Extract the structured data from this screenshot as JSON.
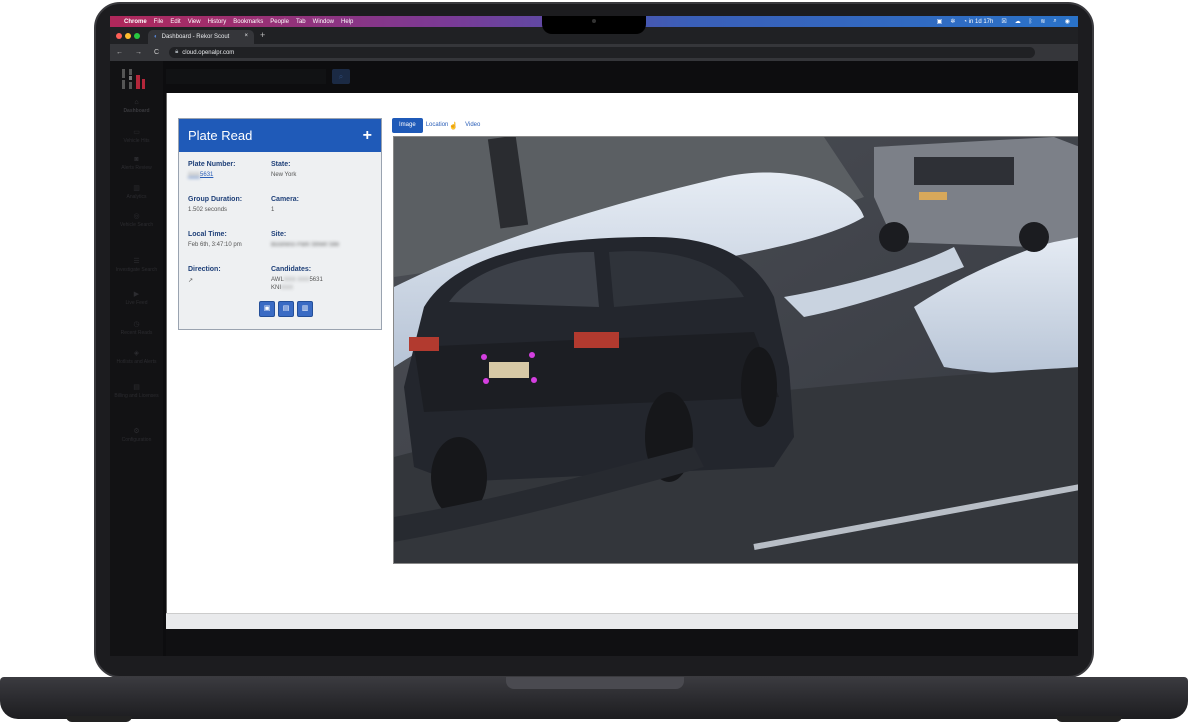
{
  "menubar": {
    "apple": "",
    "items": [
      "Chrome",
      "File",
      "Edit",
      "View",
      "History",
      "Bookmarks",
      "People",
      "Tab",
      "Window",
      "Help"
    ],
    "status_time": "in 1d 17h"
  },
  "browser": {
    "tab_title": "Dashboard - Rekor Scout",
    "tab_close": "×",
    "new_tab": "+",
    "url": "cloud.openalpr.com",
    "back": "←",
    "forward": "→",
    "reload": "C"
  },
  "sidebar": {
    "items": [
      {
        "label": "Dashboard",
        "icon": "home-icon"
      },
      {
        "label": "Vehicle Hits",
        "icon": "car-icon"
      },
      {
        "label": "Alerts Review",
        "icon": "camera-icon"
      },
      {
        "label": "Analytics",
        "icon": "chart-icon"
      },
      {
        "label": "Vehicle Search",
        "icon": "search-icon"
      },
      {
        "label": "Investigate Search",
        "icon": "list-icon"
      },
      {
        "label": "Live Feed",
        "icon": "video-icon"
      },
      {
        "label": "Recent Reads",
        "icon": "clock-icon"
      },
      {
        "label": "Hotlists and Alerts",
        "icon": "bell-icon"
      },
      {
        "label": "Billing and Licenses",
        "icon": "card-icon"
      },
      {
        "label": "Configuration",
        "icon": "gear-icon"
      }
    ]
  },
  "plate_card": {
    "title": "Plate Read",
    "add_icon": "+",
    "fields": {
      "plate_number": {
        "label": "Plate Number:",
        "value_hidden": "XXX",
        "value_visible": "5631"
      },
      "state": {
        "label": "State:",
        "value": "New York"
      },
      "group_duration": {
        "label": "Group Duration:",
        "value": "1.502 seconds"
      },
      "camera": {
        "label": "Camera:",
        "value": "1"
      },
      "local_time": {
        "label": "Local Time:",
        "value": "Feb 6th, 3:47:10 pm"
      },
      "site": {
        "label": "Site:",
        "value_hidden": "Business Park Street Site"
      },
      "direction": {
        "label": "Direction:",
        "value": "↗"
      },
      "candidates": {
        "label": "Candidates:",
        "lines": [
          {
            "prefix": "AWL",
            "hidden": "XXX XXX",
            "suffix": "5631"
          },
          {
            "prefix": "KNI",
            "hidden": "XXX",
            "suffix": ""
          }
        ]
      }
    }
  },
  "media_tabs": {
    "image": "Image",
    "location": "Location",
    "video": "Video"
  },
  "colors": {
    "accent": "#1f5ab8",
    "label": "#1e3f78",
    "marker": "#d43fe0"
  }
}
